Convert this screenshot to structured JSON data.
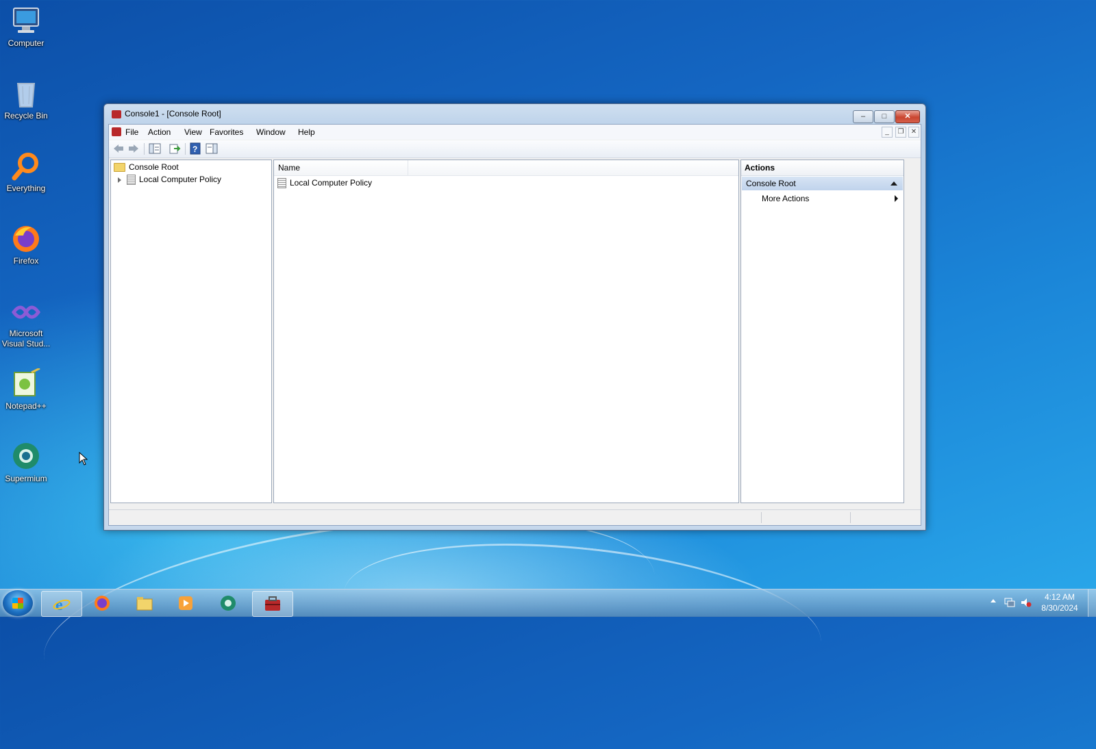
{
  "desktop": {
    "icons": [
      {
        "label": "Computer",
        "icon": "computer-icon"
      },
      {
        "label": "Recycle Bin",
        "icon": "recycle-bin-icon"
      },
      {
        "label": "Everything",
        "icon": "everything-search-icon"
      },
      {
        "label": "Firefox",
        "icon": "firefox-icon"
      },
      {
        "label": "Microsoft Visual Stud...",
        "icon": "visual-studio-icon"
      },
      {
        "label": "Notepad++",
        "icon": "notepadpp-icon"
      },
      {
        "label": "Supermium",
        "icon": "supermium-icon"
      }
    ]
  },
  "window": {
    "title": "Console1 - [Console Root]",
    "caption_buttons": {
      "minimize": "–",
      "maximize": "□",
      "close": "✕"
    },
    "menu": [
      "File",
      "Action",
      "View",
      "Favorites",
      "Window",
      "Help"
    ],
    "mdi_buttons": {
      "minimize": "_",
      "restore": "❐",
      "close": "✕"
    },
    "toolbar_icons": [
      "back-arrow-icon",
      "forward-arrow-icon",
      "show-hide-tree-icon",
      "export-list-icon",
      "help-icon",
      "show-hide-action-pane-icon"
    ],
    "tree": {
      "root": "Console Root",
      "children": [
        "Local Computer Policy"
      ]
    },
    "list": {
      "columns": [
        "Name"
      ],
      "rows": [
        "Local Computer Policy"
      ]
    },
    "actions": {
      "title": "Actions",
      "group": "Console Root",
      "items": [
        "More Actions"
      ]
    }
  },
  "taskbar": {
    "apps": [
      "internet-explorer-icon",
      "firefox-icon",
      "file-explorer-icon",
      "media-player-icon",
      "supermium-icon",
      "mmc-console-icon"
    ],
    "clock": {
      "time": "4:12 AM",
      "date": "8/30/2024"
    }
  }
}
